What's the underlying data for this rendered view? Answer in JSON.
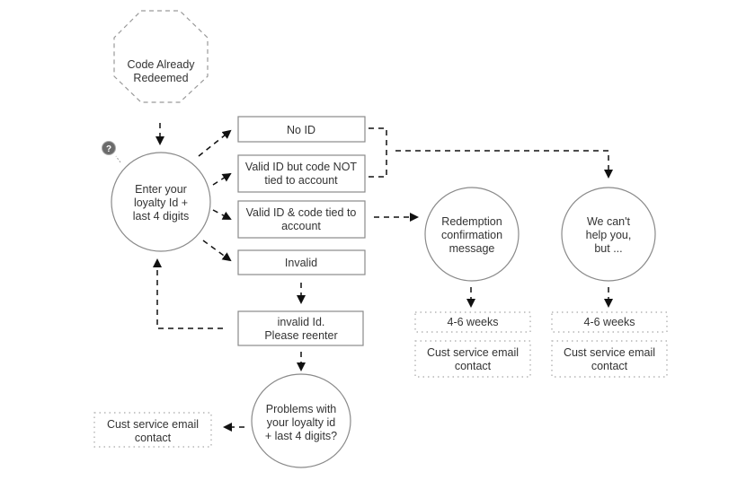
{
  "nodes": {
    "code_redeemed": [
      "Code Already",
      "Redeemed"
    ],
    "enter_id": [
      "Enter your",
      "loyalty Id +",
      "last 4 digits"
    ],
    "no_id": [
      "No ID"
    ],
    "valid_not_tied": [
      "Valid ID but code NOT",
      "tied to account"
    ],
    "valid_tied": [
      "Valid ID & code tied to",
      "account"
    ],
    "invalid": [
      "Invalid"
    ],
    "reenter": [
      "invalid Id.",
      "Please reenter"
    ],
    "problems": [
      "Problems with",
      "your loyalty id",
      "+ last 4 digits?"
    ],
    "cust_left": [
      "Cust service email",
      "contact"
    ],
    "redemption": [
      "Redemption",
      "confirmation",
      "message"
    ],
    "cant_help": [
      "We can't",
      "help you,",
      "but ..."
    ],
    "weeks_1": [
      "4-6 weeks"
    ],
    "cust_mid": [
      "Cust service email",
      "contact"
    ],
    "weeks_2": [
      "4-6 weeks"
    ],
    "cust_right": [
      "Cust service email",
      "contact"
    ]
  },
  "icons": {
    "help": "question-mark-icon"
  },
  "colors": {
    "stroke": "#8a8a8a",
    "connector": "#111111",
    "help_icon": "#6b6b6b"
  }
}
